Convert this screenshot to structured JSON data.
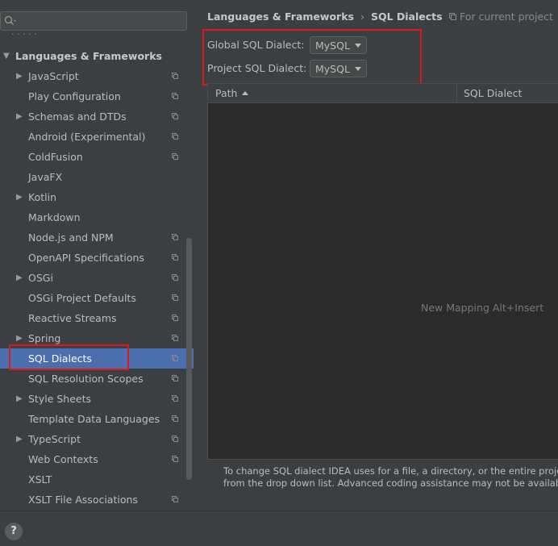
{
  "sidebar": {
    "search": {
      "placeholder": "",
      "value": ""
    },
    "cut_item": "· · · · ·",
    "items": [
      {
        "label": "Languages & Frameworks",
        "level": "root",
        "arrow": "down",
        "icon": false
      },
      {
        "label": "JavaScript",
        "level": "child",
        "arrow": "right",
        "icon": true
      },
      {
        "label": "Play Configuration",
        "level": "child",
        "arrow": "",
        "icon": true
      },
      {
        "label": "Schemas and DTDs",
        "level": "child",
        "arrow": "right",
        "icon": true
      },
      {
        "label": "Android (Experimental)",
        "level": "child",
        "arrow": "",
        "icon": true
      },
      {
        "label": "ColdFusion",
        "level": "child",
        "arrow": "",
        "icon": true
      },
      {
        "label": "JavaFX",
        "level": "child",
        "arrow": "",
        "icon": false
      },
      {
        "label": "Kotlin",
        "level": "child",
        "arrow": "right",
        "icon": false
      },
      {
        "label": "Markdown",
        "level": "child",
        "arrow": "",
        "icon": false
      },
      {
        "label": "Node.js and NPM",
        "level": "child",
        "arrow": "",
        "icon": true
      },
      {
        "label": "OpenAPI Specifications",
        "level": "child",
        "arrow": "",
        "icon": true
      },
      {
        "label": "OSGi",
        "level": "child",
        "arrow": "right",
        "icon": true
      },
      {
        "label": "OSGi Project Defaults",
        "level": "child",
        "arrow": "",
        "icon": true
      },
      {
        "label": "Reactive Streams",
        "level": "child",
        "arrow": "",
        "icon": true
      },
      {
        "label": "Spring",
        "level": "child",
        "arrow": "right",
        "icon": true
      },
      {
        "label": "SQL Dialects",
        "level": "child",
        "arrow": "",
        "icon": true,
        "selected": true
      },
      {
        "label": "SQL Resolution Scopes",
        "level": "child",
        "arrow": "",
        "icon": true
      },
      {
        "label": "Style Sheets",
        "level": "child",
        "arrow": "right",
        "icon": true
      },
      {
        "label": "Template Data Languages",
        "level": "child",
        "arrow": "",
        "icon": true
      },
      {
        "label": "TypeScript",
        "level": "child",
        "arrow": "right",
        "icon": true
      },
      {
        "label": "Web Contexts",
        "level": "child",
        "arrow": "",
        "icon": true
      },
      {
        "label": "XSLT",
        "level": "child",
        "arrow": "",
        "icon": false
      },
      {
        "label": "XSLT File Associations",
        "level": "child",
        "arrow": "",
        "icon": true
      }
    ]
  },
  "header": {
    "breadcrumb_parent": "Languages & Frameworks",
    "breadcrumb_sep": "›",
    "breadcrumb_current": "SQL Dialects",
    "scope_note": "For current project"
  },
  "form": {
    "global_label": "Global SQL Dialect:",
    "global_value": "MySQL",
    "project_label": "Project SQL Dialect:",
    "project_value": "MySQL"
  },
  "table": {
    "col_path": "Path",
    "col_dialect": "SQL Dialect",
    "empty_text": "New Mapping Alt+Insert"
  },
  "help_text": {
    "line1": "To change SQL dialect IDEA uses for a file, a directory, or the entire project, add",
    "line2": "from the drop down list. Advanced coding assistance may not be available for C"
  },
  "footer": {
    "help_button": "?"
  },
  "colors": {
    "background": "#3c3f41",
    "selection": "#4b6eaf",
    "table_background": "#2b2b2b",
    "highlight": "#e0161c"
  }
}
